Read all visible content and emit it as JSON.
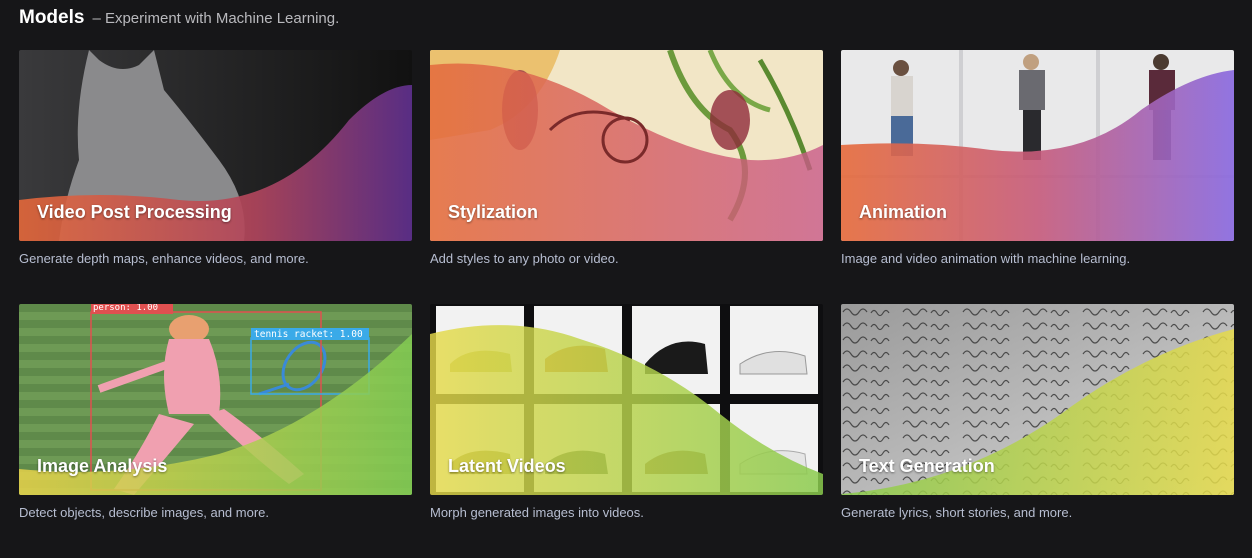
{
  "header": {
    "title": "Models",
    "subtitle": "– Experiment with Machine Learning."
  },
  "cards": [
    {
      "label": "Video Post Processing",
      "description": "Generate depth maps, enhance videos, and more."
    },
    {
      "label": "Stylization",
      "description": "Add styles to any photo or video."
    },
    {
      "label": "Animation",
      "description": "Image and video animation with machine learning."
    },
    {
      "label": "Image Analysis",
      "description": "Detect objects, describe images, and more.",
      "detections": [
        "person: 1.00",
        "tennis racket: 1.00"
      ]
    },
    {
      "label": "Latent Videos",
      "description": "Morph generated images into videos."
    },
    {
      "label": "Text Generation",
      "description": "Generate lyrics, short stories, and more."
    }
  ],
  "colors": {
    "background": "#161618",
    "warm_wave_start": "#e56a3b",
    "warm_wave_end": "#7a3fb0",
    "cool_wave_start": "#e7d64a",
    "cool_wave_end": "#7fcf4f"
  }
}
